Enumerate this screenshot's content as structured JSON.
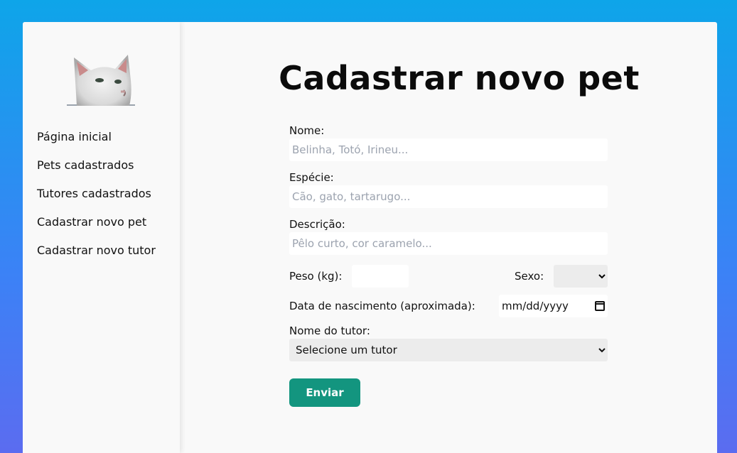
{
  "sidebar": {
    "logo_alt": "gato branco",
    "items": [
      {
        "label": "Página inicial"
      },
      {
        "label": "Pets cadastrados"
      },
      {
        "label": "Tutores cadastrados"
      },
      {
        "label": "Cadastrar novo pet"
      },
      {
        "label": "Cadastrar novo tutor"
      }
    ]
  },
  "main": {
    "title": "Cadastrar novo pet",
    "form": {
      "nome": {
        "label": "Nome:",
        "placeholder": "Belinha, Totó, Irineu...",
        "value": ""
      },
      "especie": {
        "label": "Espécie:",
        "placeholder": "Cão, gato, tartarugo...",
        "value": ""
      },
      "descricao": {
        "label": "Descrição:",
        "placeholder": "Pêlo curto, cor caramelo...",
        "value": ""
      },
      "peso": {
        "label": "Peso (kg):",
        "value": ""
      },
      "sexo": {
        "label": "Sexo:",
        "value": ""
      },
      "nascimento": {
        "label": "Data de nascimento (aproximada):",
        "placeholder": "mm/dd/yyyy"
      },
      "tutor": {
        "label": "Nome do tutor:",
        "selected": "Selecione um tutor"
      },
      "submit_label": "Enviar"
    }
  },
  "colors": {
    "accent": "#13957f",
    "background_top": "#0ea5e9",
    "background_bottom": "#5b6cf0"
  },
  "icons": [
    "cat-logo",
    "calendar-icon",
    "chevron-down-icon"
  ]
}
